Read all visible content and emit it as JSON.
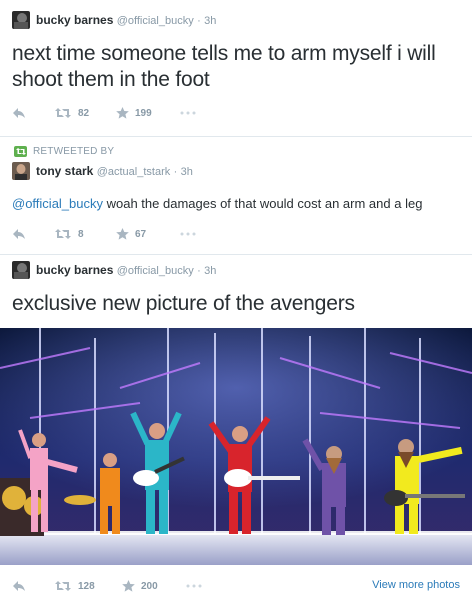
{
  "tweets": [
    {
      "name": "bucky barnes",
      "handle": "@official_bucky",
      "separator": "·",
      "time": "3h",
      "text": "next time someone tells me to arm myself i will shoot them in the foot",
      "retweets": "82",
      "favorites": "199"
    },
    {
      "retweeted_by_label": "RETWEETED BY",
      "name": "tony stark",
      "handle": "@actual_tstark",
      "separator": "·",
      "time": "3h",
      "mention": "@official_bucky",
      "text": " woah the damages of that would cost an arm and a leg",
      "retweets": "8",
      "favorites": "67"
    },
    {
      "name": "bucky barnes",
      "handle": "@official_bucky",
      "separator": "·",
      "time": "3h",
      "text": "exclusive new picture of the avengers",
      "retweets": "128",
      "favorites": "200",
      "view_more": "View more photos"
    }
  ],
  "icons": {
    "reply": "reply-icon",
    "retweet": "retweet-icon",
    "favorite": "star-icon",
    "more": "more-dots-icon"
  },
  "colors": {
    "link": "#2b7bb9",
    "muted": "#8899a6",
    "retweet_badge": "#5fb04f",
    "text": "#292f33"
  }
}
